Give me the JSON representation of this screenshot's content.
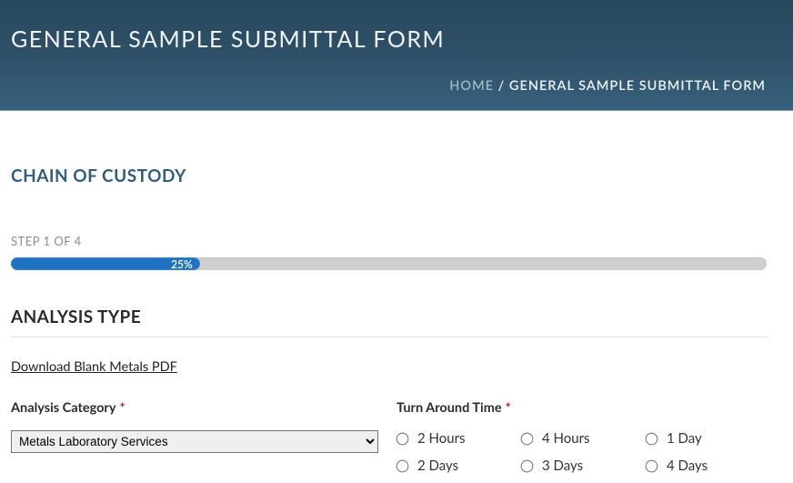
{
  "banner": {
    "title": "GENERAL SAMPLE SUBMITTAL FORM",
    "breadcrumb": {
      "home": "HOME",
      "sep": " / ",
      "current": "GENERAL SAMPLE SUBMITTAL FORM"
    }
  },
  "section": {
    "chain_title": "CHAIN OF CUSTODY",
    "step_label": "STEP 1 OF 4",
    "progress_pct": "25%",
    "analysis_title": "ANALYSIS TYPE"
  },
  "links": {
    "download_pdf": "Download Blank Metals PDF"
  },
  "fields": {
    "category": {
      "label": "Analysis Category",
      "selected": "Metals Laboratory Services"
    },
    "turnaround": {
      "label": "Turn Around Time",
      "options": [
        {
          "label": "2 Hours"
        },
        {
          "label": "4 Hours"
        },
        {
          "label": "1 Day"
        },
        {
          "label": "2 Days"
        },
        {
          "label": "3 Days"
        },
        {
          "label": "4 Days"
        }
      ]
    }
  },
  "progress_width": "25%"
}
